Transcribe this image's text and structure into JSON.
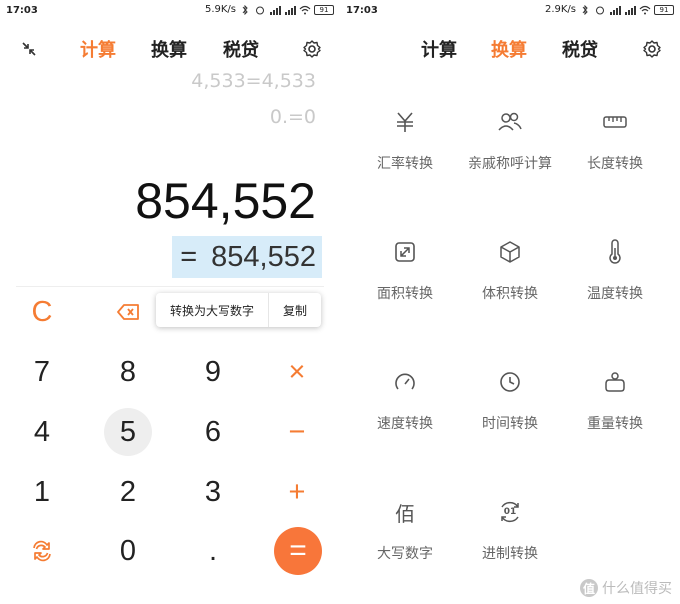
{
  "left": {
    "status": {
      "time": "17:03",
      "speed": "5.9K/s",
      "battery": "91"
    },
    "nav": {
      "tabs": [
        "计算",
        "换算",
        "税贷"
      ],
      "active": 0,
      "left_icon": "collapse-icon",
      "right_icon": "gear-icon"
    },
    "history": [
      "4,533=4,533",
      "0.=0"
    ],
    "display": {
      "number": "854,552",
      "result_eq": "=",
      "result_value": "854,552"
    },
    "context_menu": [
      "转换为大写数字",
      "复制"
    ],
    "keys": {
      "clear": "C",
      "backspace_icon": "backspace-icon",
      "k7": "7",
      "k8": "8",
      "k9": "9",
      "multiply": "×",
      "k4": "4",
      "k5": "5",
      "k6": "6",
      "minus": "−",
      "k1": "1",
      "k2": "2",
      "k3": "3",
      "plus": "+",
      "swap_icon": "swap-icon",
      "k0": "0",
      "dot": ".",
      "equals": "="
    },
    "accent": "#f57c33"
  },
  "right": {
    "status": {
      "time": "17:03",
      "speed": "2.9K/s",
      "battery": "91"
    },
    "nav": {
      "tabs": [
        "计算",
        "换算",
        "税贷"
      ],
      "active": 1,
      "right_icon": "gear-icon"
    },
    "converters": [
      {
        "label": "汇率转换",
        "icon": "currency-icon"
      },
      {
        "label": "亲戚称呼计算",
        "icon": "relatives-icon"
      },
      {
        "label": "长度转换",
        "icon": "ruler-icon"
      },
      {
        "label": "面积转换",
        "icon": "area-icon"
      },
      {
        "label": "体积转换",
        "icon": "cube-icon"
      },
      {
        "label": "温度转换",
        "icon": "thermometer-icon"
      },
      {
        "label": "速度转换",
        "icon": "speedometer-icon"
      },
      {
        "label": "时间转换",
        "icon": "clock-icon"
      },
      {
        "label": "重量转换",
        "icon": "weight-icon"
      },
      {
        "label": "大写数字",
        "icon": "bai-character-icon",
        "glyph": "佰"
      },
      {
        "label": "进制转换",
        "icon": "base-convert-icon",
        "glyph": "01"
      }
    ],
    "watermark": {
      "badge": "值",
      "text": "什么值得买"
    }
  }
}
